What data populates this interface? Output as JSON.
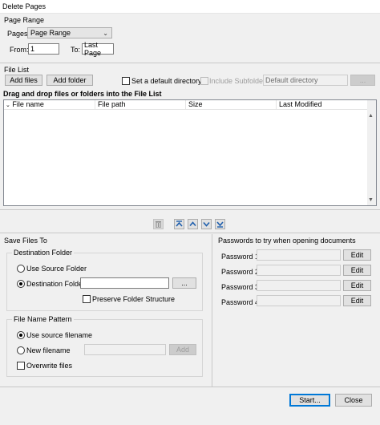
{
  "window": {
    "title": "Delete Pages"
  },
  "page_range": {
    "group_label": "Page Range",
    "pages_label": "Pages:",
    "pages_value": "Page Range",
    "from_label": "From:",
    "from_value": "1",
    "to_label": "To:",
    "to_value": "Last Page"
  },
  "file_list": {
    "group_label": "File List",
    "add_files": "Add files",
    "add_folder": "Add folder",
    "set_default_dir": "Set a default directory",
    "include_subfolders": "Include Subfolders",
    "default_dir_placeholder": "Default directory",
    "browse": "...",
    "drag_hint": "Drag and drop files or folders into the File List",
    "columns": [
      "File name",
      "File path",
      "Size",
      "Last Modified"
    ]
  },
  "toolbar_icons": [
    "trash-icon",
    "move-top-icon",
    "move-up-icon",
    "move-down-icon",
    "move-bottom-icon"
  ],
  "save_files": {
    "group_label": "Save Files To",
    "destination_folder": {
      "legend": "Destination Folder",
      "use_source": "Use Source Folder",
      "destination": "Destination Folder",
      "browse": "...",
      "preserve": "Preserve Folder Structure"
    },
    "file_name_pattern": {
      "legend": "File Name Pattern",
      "use_source_filename": "Use source filename",
      "new_filename": "New filename",
      "add": "Add",
      "overwrite": "Overwrite files"
    }
  },
  "passwords": {
    "group_label": "Passwords to try when opening documents",
    "items": [
      {
        "label": "Password 1:",
        "edit": "Edit"
      },
      {
        "label": "Password 2:",
        "edit": "Edit"
      },
      {
        "label": "Password 3:",
        "edit": "Edit"
      },
      {
        "label": "Password 4:",
        "edit": "Edit"
      }
    ]
  },
  "footer": {
    "start": "Start...",
    "close": "Close"
  }
}
